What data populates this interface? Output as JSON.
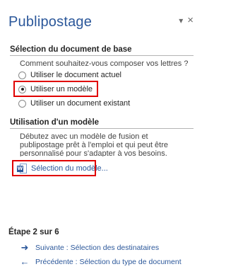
{
  "pane": {
    "title": "Publipostage",
    "dropdown_glyph": "▾",
    "close_glyph": "×"
  },
  "section1": {
    "title": "Sélection du document de base",
    "question": "Comment souhaitez-vous composer vos lettres ?",
    "options": [
      {
        "label": "Utiliser le document actuel",
        "checked": false
      },
      {
        "label": "Utiliser un modèle",
        "checked": true
      },
      {
        "label": "Utiliser un document existant",
        "checked": false
      }
    ]
  },
  "section2": {
    "title": "Utilisation d'un modèle",
    "description": "Débutez avec un modèle de fusion et publipostage prêt à l'emploi et qui peut être personnalisé pour s'adapter à vos besoins.",
    "link_label": "Sélection du modèle...",
    "link_icon": "word-document-icon"
  },
  "footer": {
    "step": "Étape 2 sur 6",
    "next_label": "Suivante : Sélection des destinataires",
    "next_icon": "arrow-right-icon",
    "prev_label": "Précédente : Sélection du type de document",
    "prev_icon": "arrow-left-icon"
  },
  "colors": {
    "accent": "#2b579a",
    "highlight": "#e00000"
  }
}
